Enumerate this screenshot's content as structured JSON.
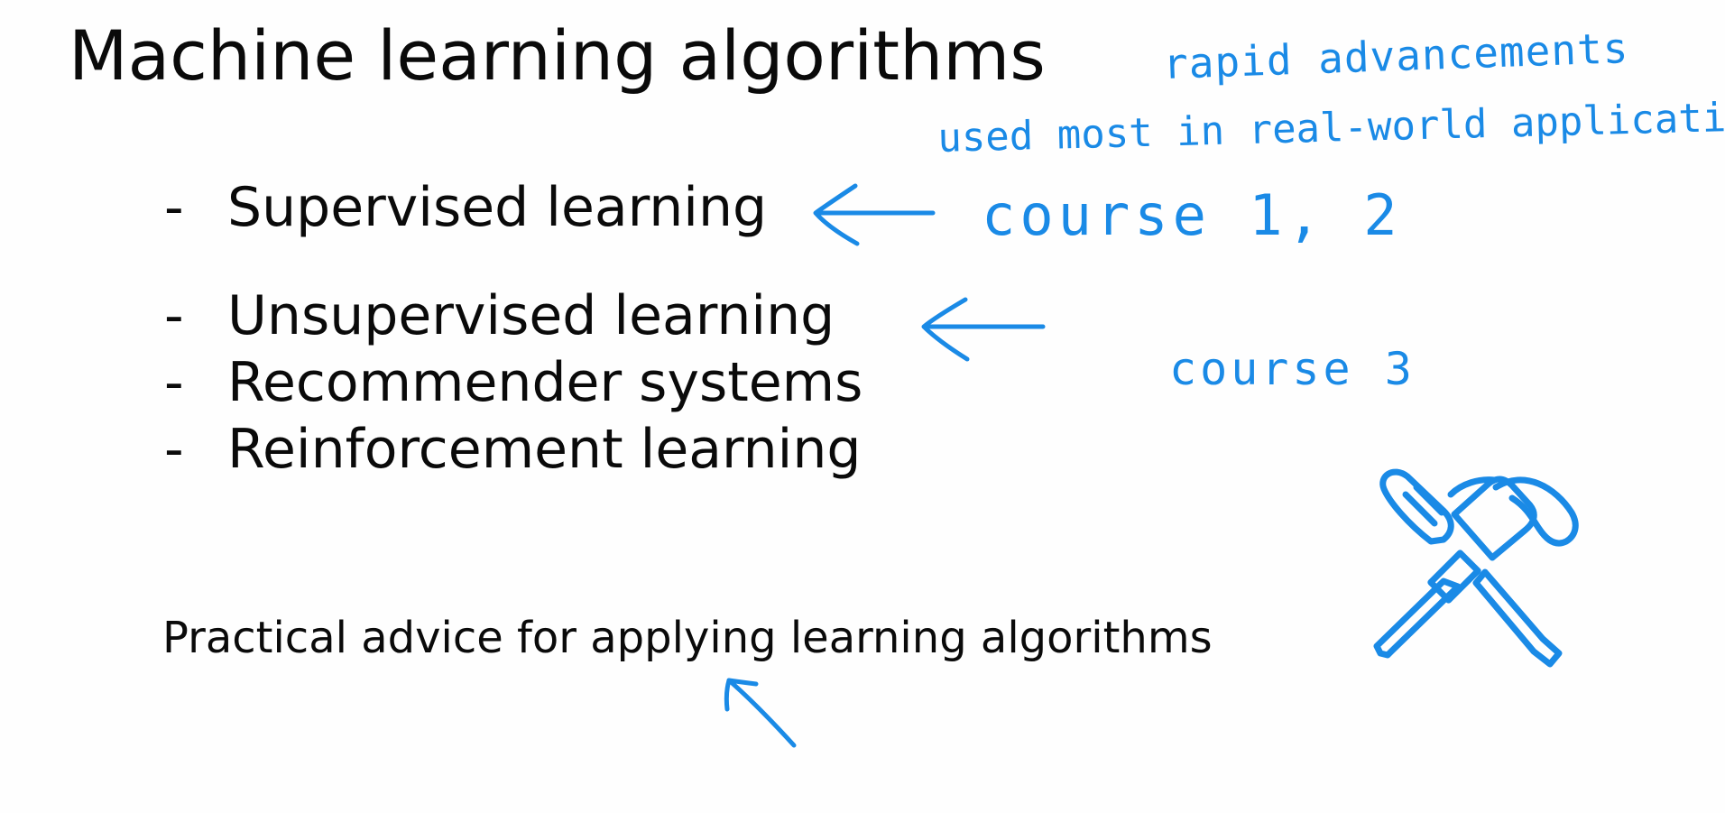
{
  "slide": {
    "title": "Machine learning algorithms",
    "bullets": [
      {
        "dash": "-",
        "label": "Supervised learning"
      },
      {
        "dash": "-",
        "label": "Unsupervised learning"
      },
      {
        "dash": "-",
        "label": "Recommender systems"
      },
      {
        "dash": "-",
        "label": "Reinforcement learning"
      }
    ],
    "footer": "Practical advice for applying learning algorithms"
  },
  "annotations": {
    "rapid": "rapid advancements",
    "used_most": "used most in real-world applications",
    "course_1_2": "course 1, 2",
    "course_3": "course 3"
  },
  "icons": {
    "tools": "wrench-hammer-icon",
    "arrows": "hand-drawn-arrow-icon"
  },
  "colors": {
    "annotation_ink": "#1a8ae6",
    "text": "#0a0a0a",
    "background": "#ffffff"
  }
}
